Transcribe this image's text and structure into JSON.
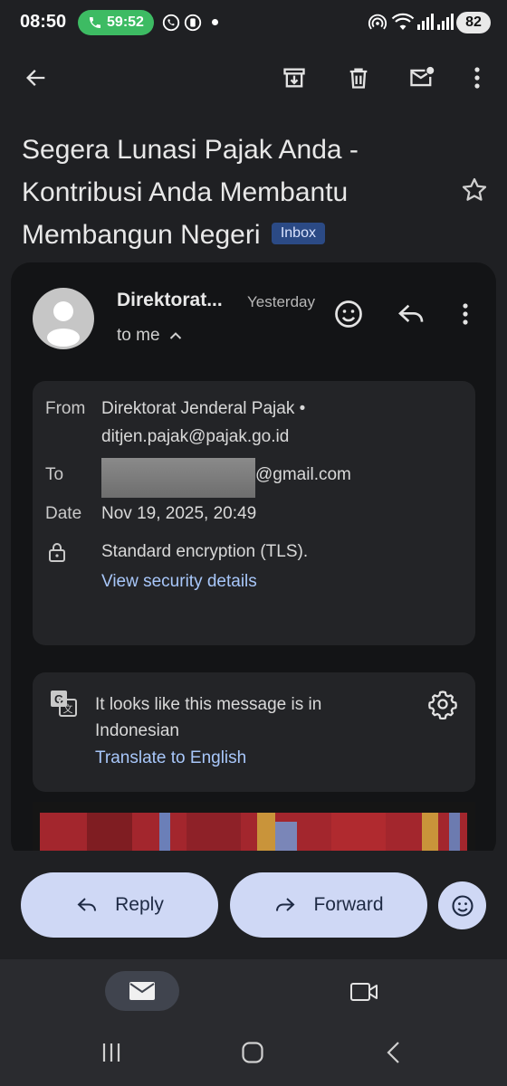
{
  "status_bar": {
    "time": "08:50",
    "call_timer": "59:52",
    "battery": "82"
  },
  "email": {
    "subject_lines": [
      "Segera Lunasi Pajak Anda -",
      "Kontribusi Anda Membantu",
      "Membangun Negeri"
    ],
    "label_chip": "Inbox",
    "sender_short": "Direktorat...",
    "time": "Yesterday",
    "recipient_line": "to me",
    "details": {
      "from_label": "From",
      "from_name": "Direktorat Jenderal Pajak •",
      "from_email": "ditjen.pajak@pajak.go.id",
      "to_label": "To",
      "to_suffix": "@gmail.com",
      "date_label": "Date",
      "date_value": "Nov 19, 2025, 20:49",
      "encryption": "Standard encryption (TLS).",
      "security_link": "View security details"
    },
    "translate": {
      "message": "It looks like this message is in Indonesian",
      "link": "Translate to English"
    }
  },
  "actions": {
    "reply": "Reply",
    "forward": "Forward"
  },
  "icons": [
    "back-arrow-icon",
    "archive-icon",
    "delete-icon",
    "mark-unread-icon",
    "more-vert-icon",
    "star-icon",
    "emoji-icon",
    "reply-icon",
    "lock-icon",
    "translate-icon",
    "settings-icon",
    "mail-icon",
    "video-icon"
  ],
  "colors": {
    "background": "#1f2023",
    "card": "#131416",
    "link": "#a8c7fa",
    "chip": "#2b4a85",
    "pill": "#cfd8f5",
    "call_pill": "#3dbb63"
  }
}
